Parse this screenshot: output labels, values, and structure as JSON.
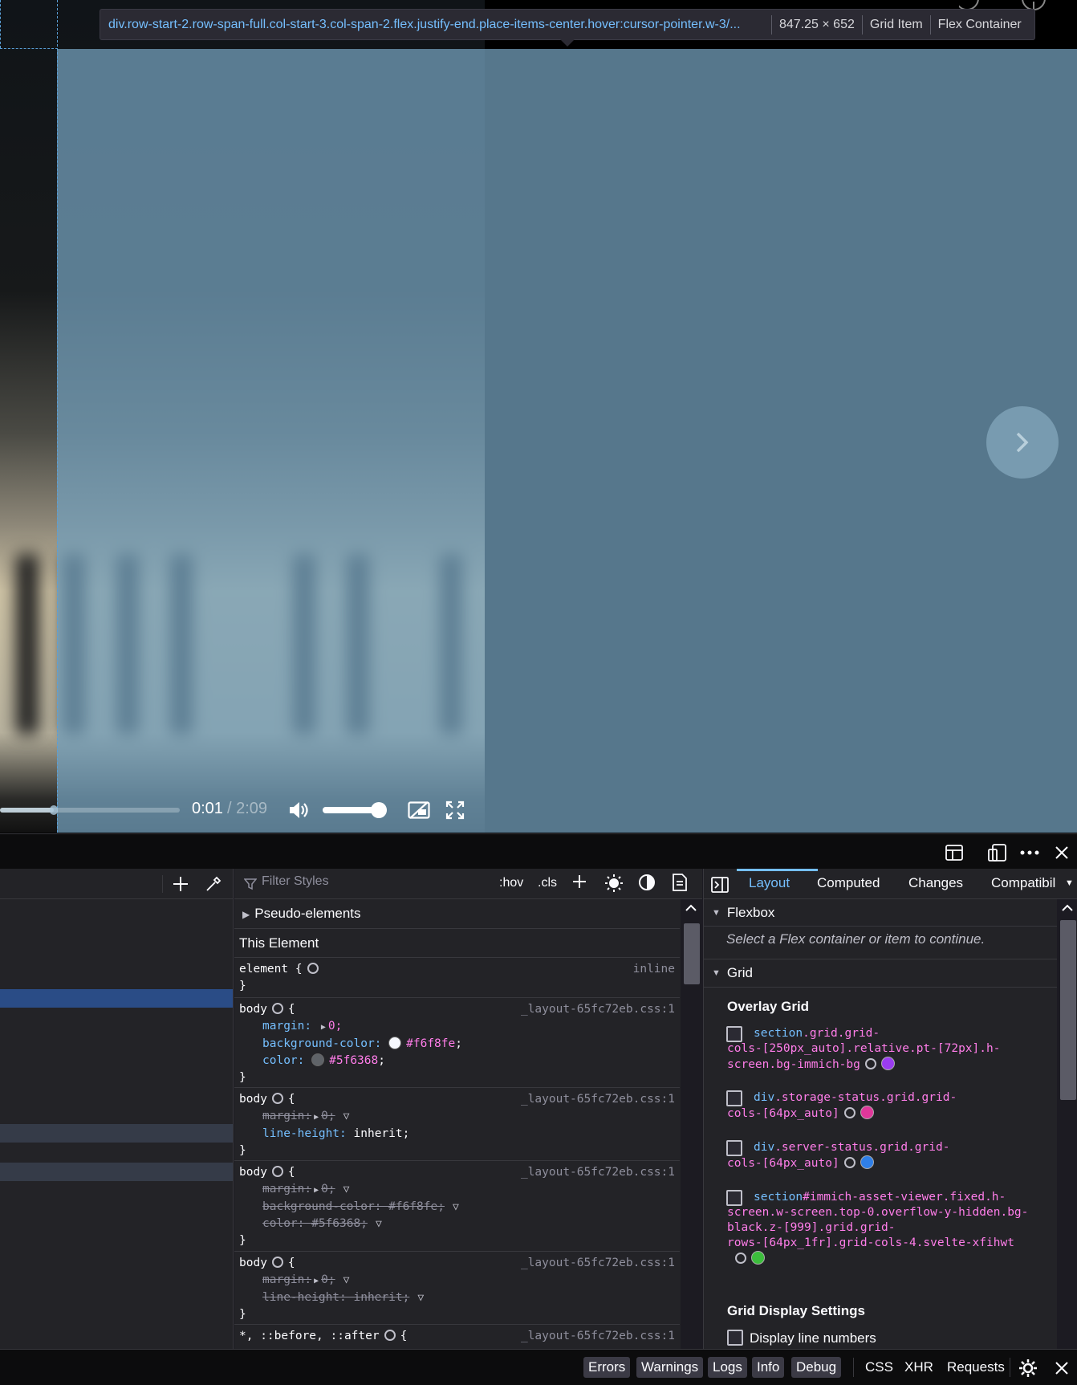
{
  "tooltip": {
    "selector": "div.row-start-2.row-span-full.col-start-3.col-span-2.flex.justify-end.place-items-center.hover:cursor-pointer.w-3/...",
    "size": "847.25 × 652",
    "badge1": "Grid Item",
    "badge2": "Flex Container"
  },
  "video": {
    "current_time": "0:01",
    "duration": "/ 2:09",
    "progress_fraction": 0.3,
    "volume_fraction": 0.88
  },
  "styles": {
    "filter_placeholder": "Filter Styles",
    "hov": ":hov",
    "cls": ".cls",
    "pseudo_elements": "Pseudo-elements",
    "this_element": "This Element",
    "element_selector": "element {",
    "element_source": "inline",
    "close_brace": "}",
    "rules": [
      {
        "selector": "body",
        "source": "_layout-65fc72eb.css:1"
      },
      {
        "selector": "body",
        "source": "_layout-65fc72eb.css:1"
      },
      {
        "selector": "body",
        "source": "_layout-65fc72eb.css:1"
      },
      {
        "selector": "body",
        "source": "_layout-65fc72eb.css:1"
      },
      {
        "selector": "*, ::before, ::after",
        "source": "_layout-65fc72eb.css:1"
      }
    ],
    "props": {
      "margin": "margin:",
      "margin_val": "0;",
      "bg": "background-color:",
      "bg_val": "#f6f8fe",
      "color": "color:",
      "color_val": "#5f6368",
      "line_height": "line-height:",
      "line_height_val": "inherit;",
      "bg_over": "background-color: #f6f8fe;",
      "color_over": "color: #5f6368;",
      "margin_over": "margin:",
      "line_height_over": "line-height: inherit;"
    }
  },
  "sidebar": {
    "tabs": [
      "Layout",
      "Computed",
      "Changes",
      "Compatibil"
    ],
    "flexbox_title": "Flexbox",
    "flexbox_msg": "Select a Flex container or item to continue.",
    "grid_title": "Grid",
    "overlay_grid": "Overlay Grid",
    "grid_items": [
      {
        "acc": "section",
        "rest": ".grid.grid-",
        "line2": "cols-[250px_auto].relative.pt-[72px].h-",
        "line3": "screen.bg-immich-bg",
        "color": "#9a3cf0"
      },
      {
        "acc": "div",
        "rest": ".storage-status.grid.grid-",
        "line2": "cols-[64px_auto]",
        "color": "#e0379a"
      },
      {
        "acc": "div",
        "rest": ".server-status.grid.grid-",
        "line2": "cols-[64px_auto]",
        "color": "#2f7fe8"
      },
      {
        "acc": "section",
        "rest": "#immich-asset-viewer.fixed.h-",
        "line2": "screen.w-screen.top-0.overflow-y-hidden.bg-",
        "line3": "black.z-[999].grid.grid-",
        "line4": "rows-[64px_1fr].grid-cols-4.svelte-xfihwt",
        "color": "#3cbd3c"
      }
    ],
    "grid_display_settings": "Grid Display Settings",
    "display_line_numbers": "Display line numbers"
  },
  "console": {
    "filters": [
      "Errors",
      "Warnings",
      "Logs",
      "Info",
      "Debug"
    ],
    "types": [
      "CSS",
      "XHR",
      "Requests"
    ]
  },
  "colors": {
    "highlight": "#739fbb",
    "accent": "#75bfff",
    "css_value": "#ff7de9"
  }
}
